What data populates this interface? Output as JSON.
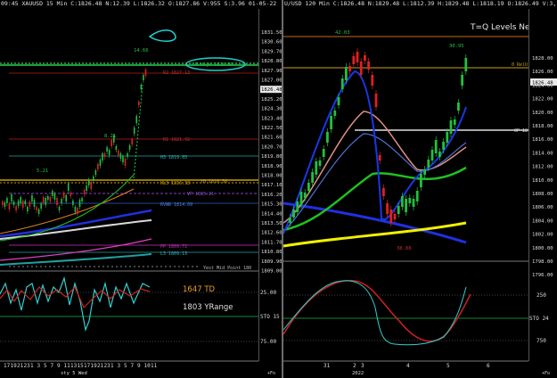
{
  "left": {
    "header": "XAUUSD 15 Min  C:1826.48  N:12.39  L:1826.32  O:1827.86  V:955  S:3.96  01-05-22",
    "header_time": "09:45",
    "price_labels": [
      "1831.50",
      "1830.60",
      "1829.70",
      "1828.80",
      "1827.90",
      "1827.00",
      "1826.48",
      "1825.20",
      "1824.30",
      "1823.40",
      "1822.50",
      "1821.60",
      "1820.70",
      "1819.80",
      "1818.90",
      "1818.00",
      "1817.10",
      "1816.20",
      "1815.30",
      "1814.40",
      "1813.50",
      "1812.60",
      "1811.70",
      "1810.80",
      "1809.90",
      "1809.00"
    ],
    "current_price": "1826.48",
    "level_labels": {
      "lm_high": "LM High 1828.56",
      "r2": "R2 1827.13",
      "r1": "R1 1821.92",
      "h3": "H3 1819.85",
      "yh": "YH 1816.56",
      "hl3": "HL3 1816.38",
      "vp": "VP 1815.21",
      "rvwr": "RVWR 1814.09",
      "pp": "PP 1809.72",
      "l3": "L3 1809.13",
      "yest_mid": "Yest Mid Point 180"
    },
    "wave_labels": [
      "14.66",
      "8.21",
      "5.21"
    ],
    "indicator": {
      "td_label": "1647 TD",
      "yrange_label": "1803 YRange",
      "levels": [
        "25.00",
        "STO 15",
        "75.00"
      ]
    },
    "time_labels": [
      "17",
      "19",
      "21",
      "23",
      "1",
      "3",
      "5",
      "7",
      "9",
      "11",
      "13",
      "15",
      "17",
      "19",
      "21",
      "23",
      "1",
      "3",
      "5",
      "7",
      "9",
      "10",
      "11"
    ],
    "bottom_caption": "sty 5 Wed",
    "corner": "+Fo"
  },
  "right": {
    "header": "U/USD 120 Min  C:1826.48  N:1829.48  L:1812.39  H:1829.48  L:1818.19  O:1826.49  V:3,711  S:1807.52  01-05-22  1:00.30",
    "title": "T=Q Levels Ne",
    "price_labels": [
      "1828.00",
      "1826.00",
      "1824.00",
      "1822.00",
      "1820.00",
      "1818.00",
      "1816.00",
      "1814.00",
      "1812.00",
      "1810.00",
      "1808.00",
      "1806.00",
      "1804.00",
      "1802.00",
      "1800.00",
      "1798.00",
      "1796.00"
    ],
    "current_price": "1826.48",
    "wave_labels": [
      "42.03",
      "30.95",
      "38.88"
    ],
    "level_labels": {
      "r_top": "0 RelU",
      "op": "OP 18"
    },
    "indicator": {
      "levels": [
        "250",
        "STO 24",
        "750"
      ]
    },
    "time_labels": [
      "31",
      "2",
      "3",
      "4",
      "5",
      "6"
    ],
    "year": "2022",
    "corner": "+Fo"
  }
}
